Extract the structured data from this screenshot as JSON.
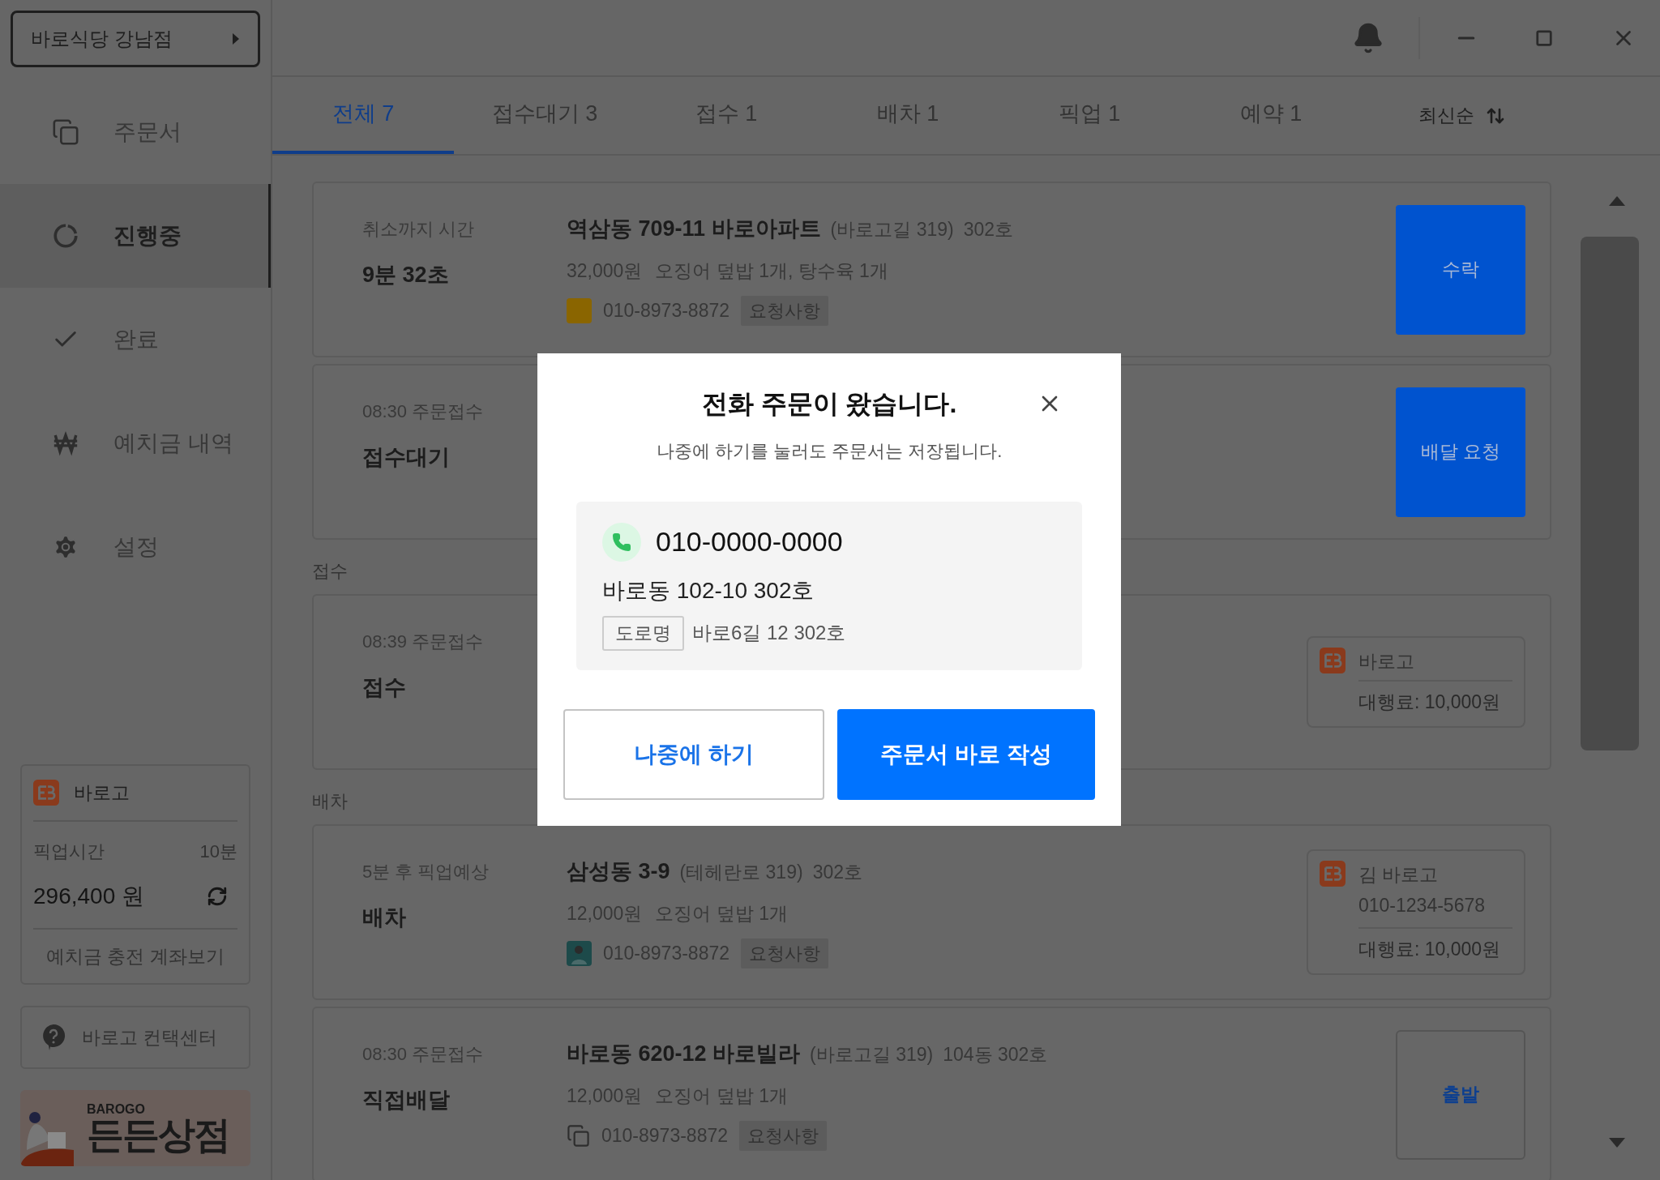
{
  "store": {
    "name": "바로식당 강남점"
  },
  "nav": [
    {
      "kind": "orders",
      "label": "주문서",
      "selected": false
    },
    {
      "kind": "progress",
      "label": "진행중",
      "selected": true
    },
    {
      "kind": "done",
      "label": "완료",
      "selected": false
    },
    {
      "kind": "deposit",
      "label": "예치금 내역",
      "selected": false
    },
    {
      "kind": "settings",
      "label": "설정",
      "selected": false
    }
  ],
  "deposit_card": {
    "brand": "바로고",
    "pickup_label": "픽업시간",
    "pickup_value": "10분",
    "balance": "296,400 원",
    "link": "예치금 충전 계좌보기"
  },
  "help": {
    "label": "바로고 컨택센터"
  },
  "banner": {
    "brand": "BAROGO",
    "title": "든든상점"
  },
  "tabs": [
    {
      "label": "전체 7",
      "selected": true
    },
    {
      "label": "접수대기 3",
      "selected": false
    },
    {
      "label": "접수 1",
      "selected": false
    },
    {
      "label": "배차 1",
      "selected": false
    },
    {
      "label": "픽업 1",
      "selected": false
    },
    {
      "label": "예약 1",
      "selected": false
    }
  ],
  "sort": {
    "label": "최신순"
  },
  "entries": [
    {
      "kind": "order",
      "time_label": "취소까지 시간",
      "status": "9분 32초",
      "address": "역삼동 709-11 바로아파트",
      "road": "(바로고길 319)",
      "unit": "302호",
      "price": "32,000원",
      "menu": "오징어 덮밥 1개, 탕수육 1개",
      "phone_icon": {
        "kind": "store"
      },
      "phone": "010-8973-8872",
      "request": "요청사항",
      "action": {
        "kind": "button",
        "label": "수락"
      }
    },
    {
      "kind": "order",
      "time_label": "08:30 주문접수",
      "status": "접수대기",
      "action": {
        "kind": "button",
        "label": "배달 요청"
      }
    },
    {
      "kind": "heading",
      "label": "접수"
    },
    {
      "kind": "order",
      "time_label": "08:39 주문접수",
      "status": "접수",
      "action": {
        "kind": "rider",
        "name": "바로고",
        "fee": "대행료: 10,000원"
      }
    },
    {
      "kind": "heading",
      "label": "배차"
    },
    {
      "kind": "order",
      "time_label": "5분 후 픽업예상",
      "status": "배차",
      "address": "삼성동 3-9",
      "road": "(테헤란로 319)",
      "unit": "302호",
      "price": "12,000원",
      "menu": "오징어 덮밥 1개",
      "phone_icon": {
        "kind": "rider"
      },
      "phone": "010-8973-8872",
      "request": "요청사항",
      "action": {
        "kind": "rider",
        "name": "김 바로고",
        "phone": "010-1234-5678",
        "fee": "대행료: 10,000원"
      }
    },
    {
      "kind": "order",
      "time_label": "08:30 주문접수",
      "status": "직접배달",
      "address": "바로동 620-12 바로빌라",
      "road": "(바로고길 319)",
      "unit": "104동 302호",
      "price": "12,000원",
      "menu": "오징어 덮밥 1개",
      "phone_icon": {
        "kind": "copy"
      },
      "phone": "010-8973-8872",
      "request": "요청사항",
      "action": {
        "kind": "outline",
        "label": "출발"
      }
    }
  ],
  "modal": {
    "title": "전화 주문이 왔습니다.",
    "subtitle": "나중에 하기를 눌러도 주문서는 저장됩니다.",
    "phone": "010-0000-0000",
    "address": "바로동 102-10 302호",
    "road_tag": "도로명",
    "road_address": "바로6길 12 302호",
    "buttons": [
      {
        "kind": "secondary",
        "label": "나중에 하기"
      },
      {
        "kind": "primary",
        "label": "주문서 바로 작성"
      }
    ]
  }
}
